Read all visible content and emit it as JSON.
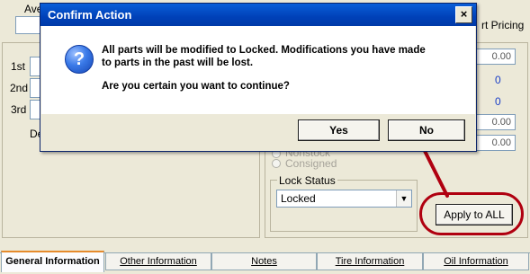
{
  "background": {
    "avg_label_partial": "Ave",
    "part_pricing_label_partial": "rt Pricing",
    "rank_labels": [
      "1st",
      "2nd",
      "3rd"
    ],
    "de_label_partial": "De",
    "right_values": [
      "0.00",
      "0",
      "0",
      "0.00",
      "0.00"
    ],
    "radio_partial_label": "Nonstock",
    "radio_consigned_label": "Consigned",
    "lock_status": {
      "label": "Lock Status",
      "selected": "Locked"
    },
    "apply_to_all_label": "Apply to ALL"
  },
  "tabs": [
    {
      "label": "General Information",
      "active": true
    },
    {
      "label": "Other Information",
      "active": false
    },
    {
      "label": "Notes",
      "active": false
    },
    {
      "label": "Tire Information",
      "active": false
    },
    {
      "label": "Oil Information",
      "active": false
    }
  ],
  "dialog": {
    "title": "Confirm Action",
    "close_glyph": "×",
    "icon": "question-icon",
    "message_line1": "All parts will be modified to Locked. Modifications you have made",
    "message_line2": "to parts in the past will be lost.",
    "question": "Are you certain you want to continue?",
    "yes_label": "Yes",
    "no_label": "No"
  },
  "annotation": {
    "color": "#b00010"
  },
  "colors": {
    "titlebar": "#0041b8",
    "dialog_face": "#ece9d8",
    "link_blue": "#1a3fc7"
  }
}
